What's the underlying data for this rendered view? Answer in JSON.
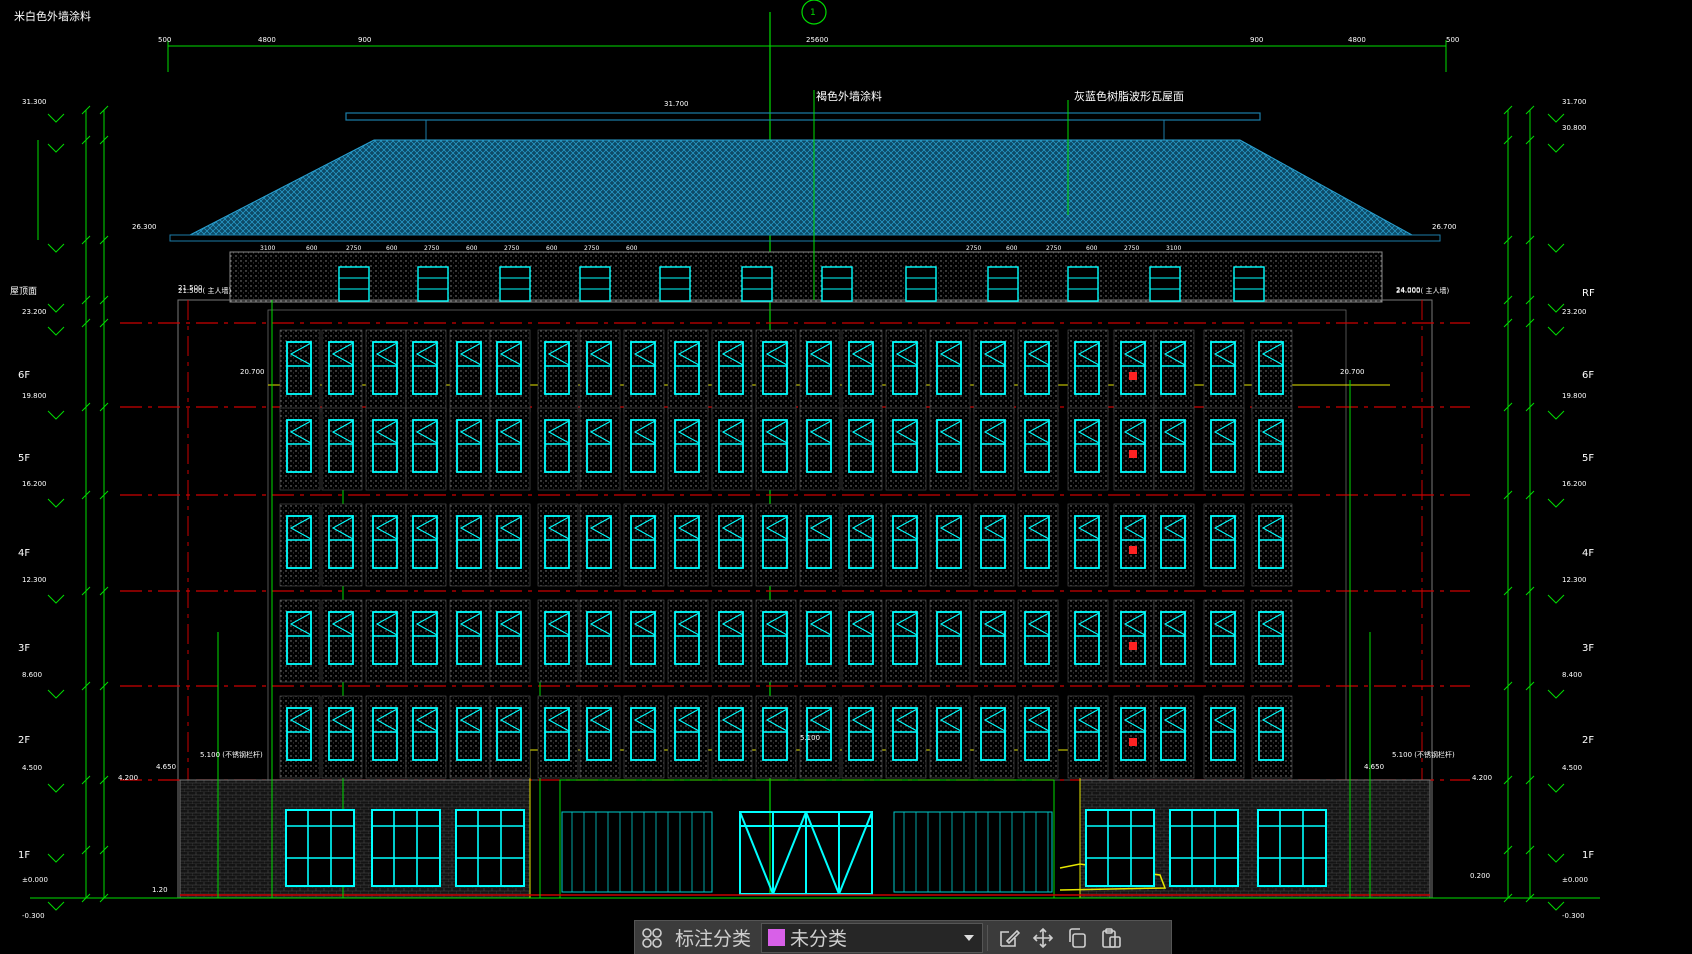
{
  "colors": {
    "background": "#000000",
    "dim": "#00dd00",
    "grid": "#cc0000",
    "glass": "#00ffff",
    "wall": "#666666",
    "roof": "#1b7da8",
    "text": "#ffffff",
    "pink": "#d860e8",
    "yellow": "#e6e600"
  },
  "drawing": {
    "note_wall_top": "米白色外墙涂料",
    "note_wall_brown": "褐色外墙涂料",
    "note_roof": "灰蓝色树脂波形瓦屋面",
    "axis_marker": "1",
    "top_dims": [
      "500",
      "4800",
      "900",
      "25600",
      "900",
      "4800",
      "500"
    ],
    "left_elevations": [
      "31.300",
      "26.300",
      "21.500",
      "23.200",
      "19.800",
      "16.200",
      "12.300",
      "8.600",
      "4.500",
      "4.200",
      "±0.000",
      "-0.300"
    ],
    "right_elevations": [
      "31.700",
      "30.800",
      "26.700",
      "24.000",
      "23.200",
      "19.800",
      "16.200",
      "12.300",
      "8.400",
      "4.500",
      "4.200",
      "±0.000",
      "-0.300"
    ],
    "floor_labels": [
      "RF",
      "6F",
      "5F",
      "4F",
      "3F",
      "2F",
      "1F"
    ],
    "left_misc": "屋顶面",
    "mid_elev": "31.700",
    "parapet_left": "21.500(  主人墙)",
    "parapet_right": "24.000(  主人墙)",
    "elev_20": "20.700",
    "canopy_left": "5.100  (不锈钢栏杆)",
    "canopy_right": "5.100  (不锈钢栏杆)",
    "canopy_mid": "5.100",
    "small_left": "4.650",
    "small_right": "4.650",
    "step_left": "1.20",
    "step_right": "0.200",
    "band_dims": [
      "3100",
      "600",
      "2750",
      "600",
      "2750",
      "600",
      "2750",
      "600",
      "2750",
      "600",
      "2750",
      "600",
      "2750",
      "600",
      "2750",
      "3100"
    ]
  },
  "toolbar": {
    "category_label": "标注分类",
    "selected_category": "未分类",
    "icons": [
      "category-grid-icon",
      "edit-icon",
      "move-icon",
      "copy-icon",
      "paste-icon"
    ]
  }
}
